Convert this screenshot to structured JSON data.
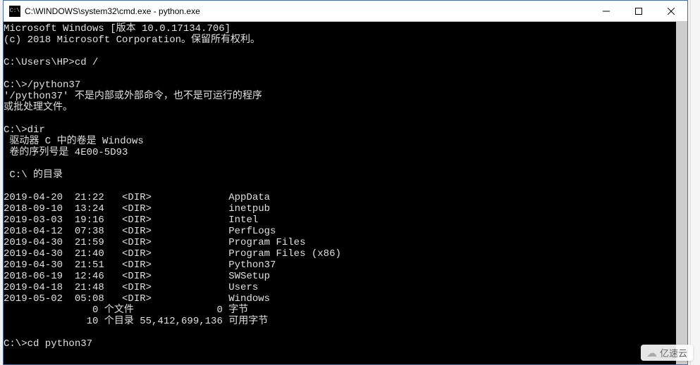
{
  "titlebar": {
    "icon_label": "C:\\",
    "title": "C:\\WINDOWS\\system32\\cmd.exe - python.exe"
  },
  "terminal": {
    "header_line1": "Microsoft Windows [版本 10.0.17134.706]",
    "header_line2": "(c) 2018 Microsoft Corporation。保留所有权利。",
    "prompt1": "C:\\Users\\HP>cd /",
    "prompt2": "C:\\>/python37",
    "error_line1": "'/python37' 不是内部或外部命令，也不是可运行的程序",
    "error_line2": "或批处理文件。",
    "prompt3": "C:\\>dir",
    "vol_line1": " 驱动器 C 中的卷是 Windows",
    "vol_line2": " 卷的序列号是 4E00-5D93",
    "dir_header": " C:\\ 的目录",
    "entries": [
      {
        "date": "2019-04-20",
        "time": "21:22",
        "type": "<DIR>",
        "name": "AppData"
      },
      {
        "date": "2018-09-10",
        "time": "13:24",
        "type": "<DIR>",
        "name": "inetpub"
      },
      {
        "date": "2019-03-03",
        "time": "19:16",
        "type": "<DIR>",
        "name": "Intel"
      },
      {
        "date": "2018-04-12",
        "time": "07:38",
        "type": "<DIR>",
        "name": "PerfLogs"
      },
      {
        "date": "2019-04-30",
        "time": "21:59",
        "type": "<DIR>",
        "name": "Program Files"
      },
      {
        "date": "2019-04-30",
        "time": "21:40",
        "type": "<DIR>",
        "name": "Program Files (x86)"
      },
      {
        "date": "2019-04-30",
        "time": "21:51",
        "type": "<DIR>",
        "name": "Python37"
      },
      {
        "date": "2018-06-19",
        "time": "12:46",
        "type": "<DIR>",
        "name": "SWSetup"
      },
      {
        "date": "2019-04-18",
        "time": "21:48",
        "type": "<DIR>",
        "name": "Users"
      },
      {
        "date": "2019-05-02",
        "time": "05:08",
        "type": "<DIR>",
        "name": "Windows"
      }
    ],
    "summary_files": "               0 个文件              0 字节",
    "summary_dirs": "              10 个目录 55,412,699,136 可用字节",
    "prompt4": "C:\\>cd python37"
  },
  "watermark": {
    "text": "亿速云"
  }
}
